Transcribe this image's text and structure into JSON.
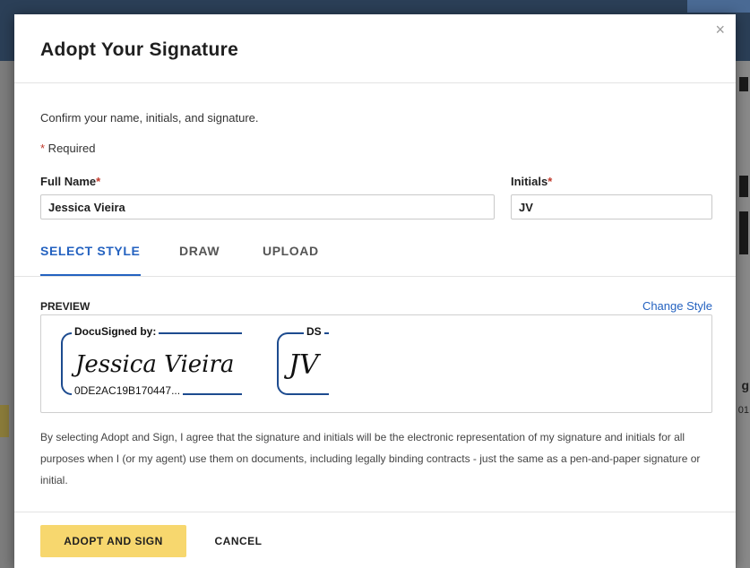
{
  "dialog": {
    "title": "Adopt Your Signature",
    "close_glyph": "×",
    "confirm_text": "Confirm your name, initials, and signature.",
    "required_star": "*",
    "required_text": " Required"
  },
  "form": {
    "full_name_label": "Full Name",
    "full_name_value": "Jessica Vieira",
    "initials_label": "Initials",
    "initials_value": "JV"
  },
  "tabs": [
    {
      "label": "SELECT STYLE",
      "active": true
    },
    {
      "label": "DRAW",
      "active": false
    },
    {
      "label": "UPLOAD",
      "active": false
    }
  ],
  "preview": {
    "label": "PREVIEW",
    "change_style": "Change Style",
    "signature": {
      "header": "DocuSigned by:",
      "text": "Jessica Vieira",
      "id": "0DE2AC19B170447..."
    },
    "initials": {
      "header": "DS",
      "text": "JV"
    }
  },
  "disclaimer": "By selecting Adopt and Sign, I agree that the signature and initials will be the electronic representation of my signature and initials for all purposes when I (or my agent) use them on documents, including legally binding contracts - just the same as a pen-and-paper signature or initial.",
  "actions": {
    "adopt": "ADOPT AND SIGN",
    "cancel": "CANCEL"
  },
  "background": {
    "right_letters": [
      "g",
      "01"
    ]
  },
  "colors": {
    "accent": "#2462c0",
    "primary_button": "#f7d76e",
    "signature_frame": "#1d4b8f",
    "required": "#c0392b"
  }
}
